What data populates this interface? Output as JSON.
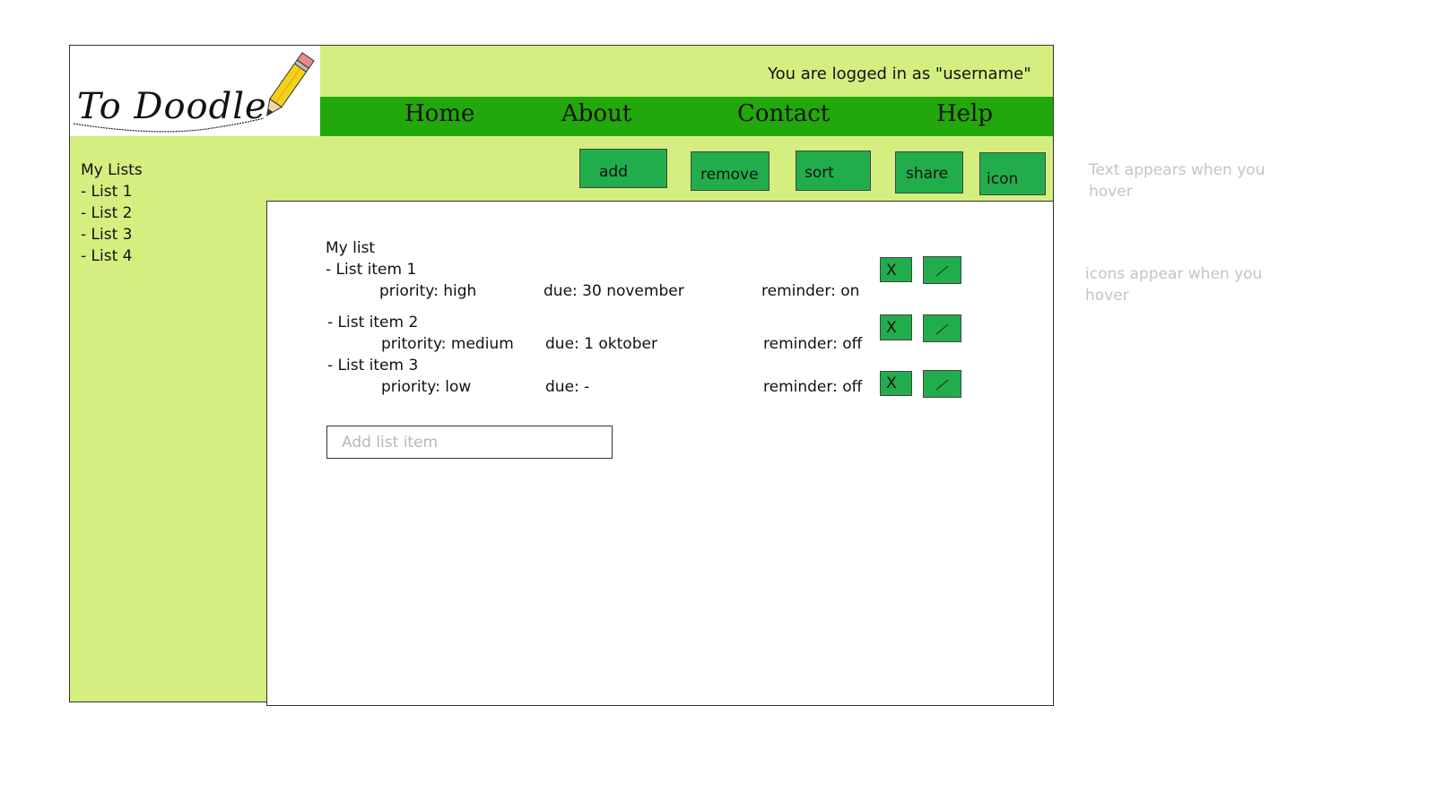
{
  "header": {
    "logo_text": "To Doodle",
    "user_line": "You are logged in as  \"username\""
  },
  "nav": {
    "items": [
      {
        "label": "Home"
      },
      {
        "label": "About"
      },
      {
        "label": "Contact"
      },
      {
        "label": "Help"
      }
    ]
  },
  "sidebar": {
    "title": "My Lists",
    "items": [
      {
        "label": "- List 1"
      },
      {
        "label": "- List 2"
      },
      {
        "label": "- List 3"
      },
      {
        "label": "- List 4"
      }
    ]
  },
  "toolbar": {
    "add": "add",
    "remove": "remove",
    "sort": "sort",
    "share": "share",
    "icon": "icon"
  },
  "list": {
    "title": "My list",
    "items": [
      {
        "name": "- List item 1",
        "priority": "priority: high",
        "due": "due: 30 november",
        "reminder": "reminder: on",
        "delete_label": "X"
      },
      {
        "name": "- List item 2",
        "priority": "pritority: medium",
        "due": "due: 1 oktober",
        "reminder": "reminder: off",
        "delete_label": "X"
      },
      {
        "name": "- List item 3",
        "priority": "priority: low",
        "due": "due: -",
        "reminder": "reminder: off",
        "delete_label": "X"
      }
    ]
  },
  "add_item": {
    "placeholder": "Add list item"
  },
  "notes": {
    "toolbar_hover": "Text appears when you hover",
    "icons_hover": "icons appear when you hover"
  },
  "colors": {
    "background_light_green": "#d4ef80",
    "nav_green": "#22a80a",
    "button_green": "#22ad4c",
    "note_gray": "#c4c4c4"
  }
}
